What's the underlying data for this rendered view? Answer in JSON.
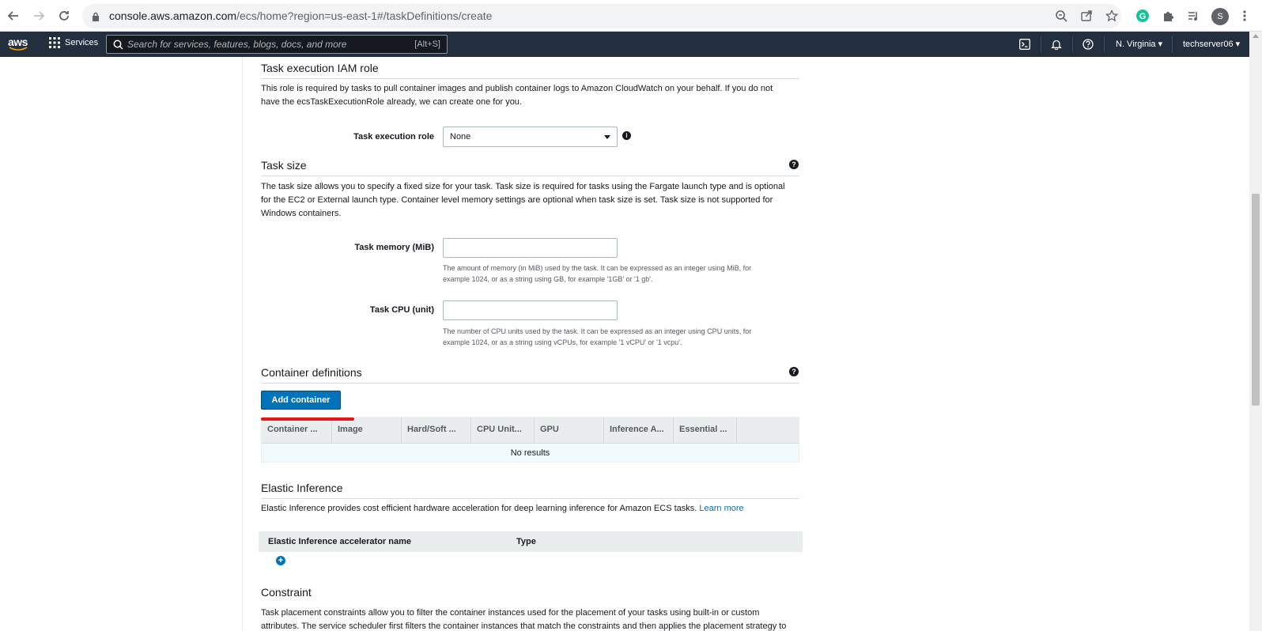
{
  "browser": {
    "url_host": "console.aws.amazon.com",
    "url_path": "/ecs/home?region=us-east-1#/taskDefinitions/create",
    "profile_initial": "S"
  },
  "aws_nav": {
    "logo_text": "aws",
    "services_label": "Services",
    "search_placeholder": "Search for services, features, blogs, docs, and more",
    "search_shortcut": "[Alt+S]",
    "region_label": "N. Virginia ▾",
    "account_label": "techserver06 ▾"
  },
  "task_execution": {
    "title": "Task execution IAM role",
    "description_line1": "This role is required by tasks to pull container images and publish container logs to Amazon CloudWatch on your behalf. If you do not",
    "description_line2": "have the ecsTaskExecutionRole already, we can create one for you.",
    "role_label": "Task execution role",
    "role_value": "None"
  },
  "task_size": {
    "title": "Task size",
    "description_line1": "The task size allows you to specify a fixed size for your task. Task size is required for tasks using the Fargate launch type and is optional",
    "description_line2": "for the EC2 or External launch type. Container level memory settings are optional when task size is set. Task size is not supported for",
    "description_line3": "Windows containers.",
    "memory_label": "Task memory (MiB)",
    "memory_value": "",
    "memory_hint_line1": "The amount of memory (in MiB) used by the task. It can be expressed as an integer using MiB, for",
    "memory_hint_line2": "example 1024, or as a string using GB, for example '1GB' or '1 gb'.",
    "cpu_label": "Task CPU (unit)",
    "cpu_value": "",
    "cpu_hint_line1": "The number of CPU units used by the task. It can be expressed as an integer using CPU units, for",
    "cpu_hint_line2": "example 1024, or as a string using vCPUs, for example '1 vCPU' or '1 vcpu'."
  },
  "container_definitions": {
    "title": "Container definitions",
    "add_button": "Add container",
    "columns": [
      "Container ...",
      "Image",
      "Hard/Soft ...",
      "CPU Unit...",
      "GPU",
      "Inference A...",
      "Essential ..."
    ],
    "empty_text": "No results"
  },
  "elastic_inference": {
    "title": "Elastic Inference",
    "description": "Elastic Inference provides cost efficient hardware acceleration for deep learning inference for Amazon ECS tasks.",
    "learn_more": "Learn more",
    "col_name": "Elastic Inference accelerator name",
    "col_type": "Type"
  },
  "constraint": {
    "title": "Constraint",
    "description_line1": "Task placement constraints allow you to filter the container instances used for the placement of your tasks using built-in or custom",
    "description_line2": "attributes. The service scheduler first filters the container instances that match the constraints and then applies the placement strategy to"
  },
  "colors": {
    "aws_nav_bg": "#232f3e",
    "primary_button": "#0073bb",
    "highlight_underline": "#e3141a"
  }
}
